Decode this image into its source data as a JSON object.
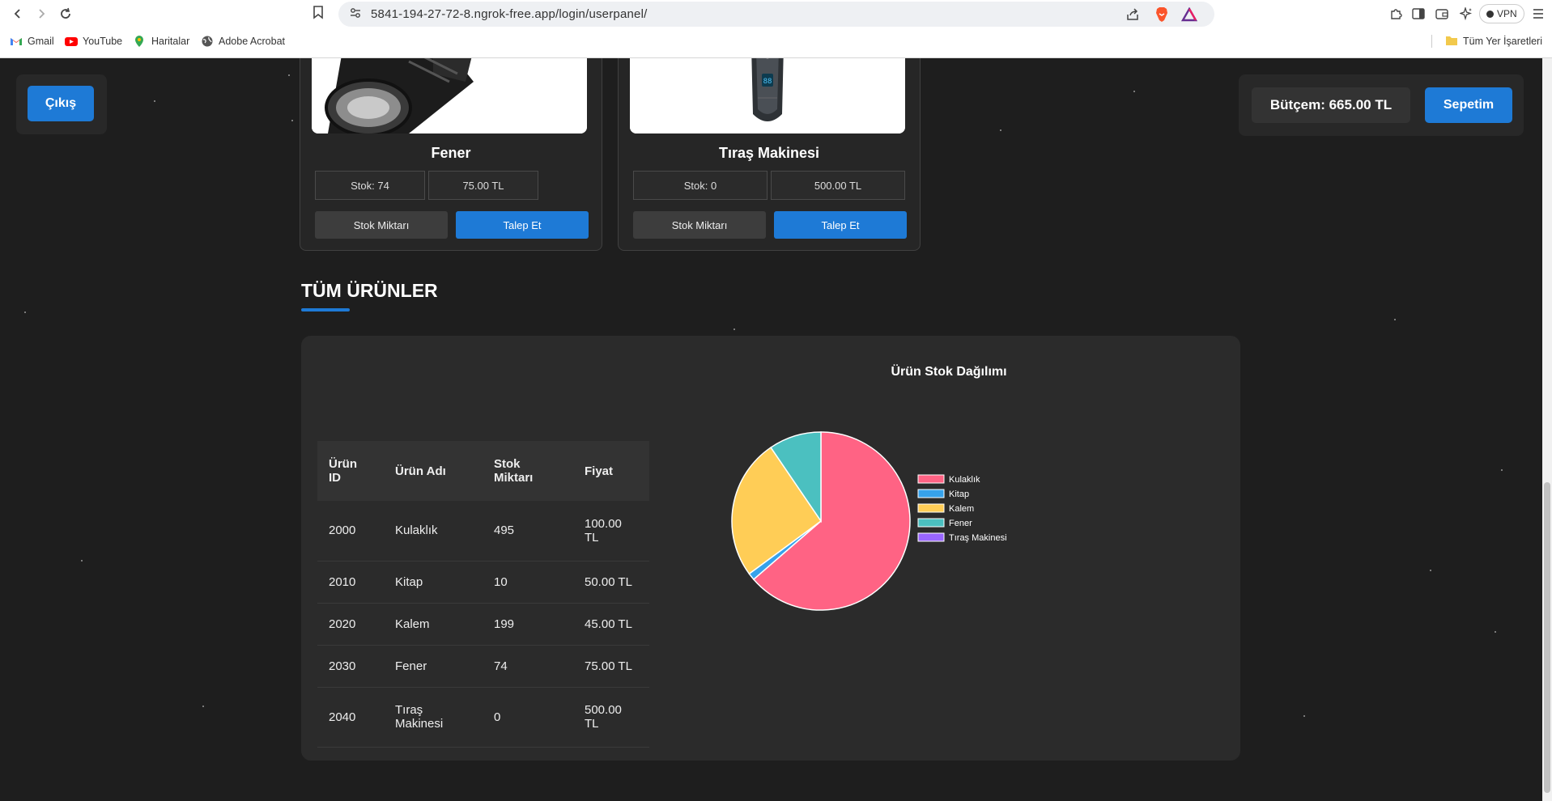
{
  "browser": {
    "url": "5841-194-27-72-8.ngrok-free.app/login/userpanel/",
    "vpn_label": "VPN",
    "bookmarks": [
      "Gmail",
      "YouTube",
      "Haritalar",
      "Adobe Acrobat"
    ],
    "all_bookmarks_label": "Tüm Yer İşaretleri"
  },
  "header": {
    "logout_label": "Çıkış",
    "budget_label": "Bütçem: 665.00 TL",
    "cart_label": "Sepetim"
  },
  "cards": [
    {
      "title": "Fener",
      "stock_text": "Stok: 74",
      "price_text": "75.00 TL",
      "stock_button": "Stok Miktarı",
      "request_button": "Talep Et"
    },
    {
      "title": "Tıraş Makinesi",
      "stock_text": "Stok: 0",
      "price_text": "500.00 TL",
      "stock_button": "Stok Miktarı",
      "request_button": "Talep Et"
    }
  ],
  "section_title": "TÜM ÜRÜNLER",
  "table": {
    "headers": [
      "Ürün ID",
      "Ürün Adı",
      "Stok Miktarı",
      "Fiyat"
    ],
    "rows": [
      [
        "2000",
        "Kulaklık",
        "495",
        "100.00 TL"
      ],
      [
        "2010",
        "Kitap",
        "10",
        "50.00 TL"
      ],
      [
        "2020",
        "Kalem",
        "199",
        "45.00 TL"
      ],
      [
        "2030",
        "Fener",
        "74",
        "75.00 TL"
      ],
      [
        "2040",
        "Tıraş Makinesi",
        "0",
        "500.00 TL"
      ]
    ]
  },
  "chart_data": {
    "type": "pie",
    "title": "Ürün Stok Dağılımı",
    "categories": [
      "Kulaklık",
      "Kitap",
      "Kalem",
      "Fener",
      "Tıraş Makinesi"
    ],
    "values": [
      495,
      10,
      199,
      74,
      0
    ],
    "colors": [
      "#ff6384",
      "#36a2eb",
      "#ffcd56",
      "#4bc0c0",
      "#9966ff"
    ],
    "legend": "right"
  }
}
